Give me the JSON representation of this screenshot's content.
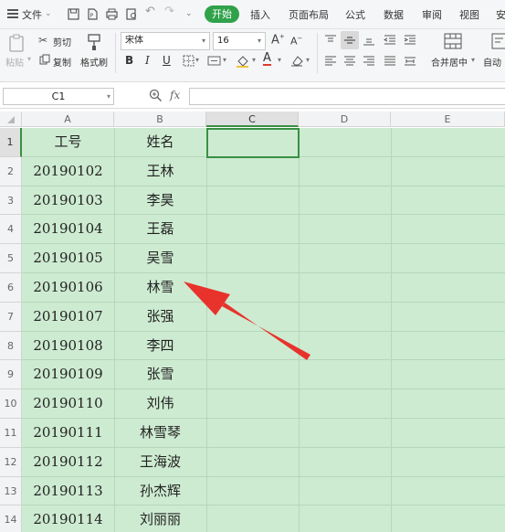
{
  "menu": {
    "file_label": "文件",
    "tabs": [
      {
        "label": "开始",
        "active": true
      },
      {
        "label": "插入"
      },
      {
        "label": "页面布局"
      },
      {
        "label": "公式"
      },
      {
        "label": "数据"
      },
      {
        "label": "审阅"
      },
      {
        "label": "视图"
      },
      {
        "label": "安"
      }
    ]
  },
  "ribbon": {
    "paste": "粘贴",
    "cut": "剪切",
    "copy": "复制",
    "format_painter": "格式刷",
    "font_name": "宋体",
    "font_size": "16",
    "merge_center": "合并居中",
    "auto_wrap": "自动"
  },
  "formula_bar": {
    "cell_ref": "C1",
    "fx_label": "fx",
    "value": ""
  },
  "grid": {
    "columns": [
      "A",
      "B",
      "C",
      "D",
      "E"
    ],
    "active_column": "C",
    "rows": [
      {
        "num": "1",
        "a": "工号",
        "b": "姓名"
      },
      {
        "num": "2",
        "a": "20190102",
        "b": "王林"
      },
      {
        "num": "3",
        "a": "20190103",
        "b": "李昊"
      },
      {
        "num": "4",
        "a": "20190104",
        "b": "王磊"
      },
      {
        "num": "5",
        "a": "20190105",
        "b": "吴雪"
      },
      {
        "num": "6",
        "a": "20190106",
        "b": "林雪"
      },
      {
        "num": "7",
        "a": "20190107",
        "b": "张强"
      },
      {
        "num": "8",
        "a": "20190108",
        "b": "李四"
      },
      {
        "num": "9",
        "a": "20190109",
        "b": "张雪"
      },
      {
        "num": "10",
        "a": "20190110",
        "b": "刘伟"
      },
      {
        "num": "11",
        "a": "20190111",
        "b": "林雪琴"
      },
      {
        "num": "12",
        "a": "20190112",
        "b": "王海波"
      },
      {
        "num": "13",
        "a": "20190113",
        "b": "孙杰辉"
      },
      {
        "num": "14",
        "a": "20190114",
        "b": "刘丽丽"
      }
    ]
  },
  "colors": {
    "accent": "#2fa24a",
    "sheet_fill": "#cdebd1",
    "annotation_arrow": "#e8322c"
  }
}
